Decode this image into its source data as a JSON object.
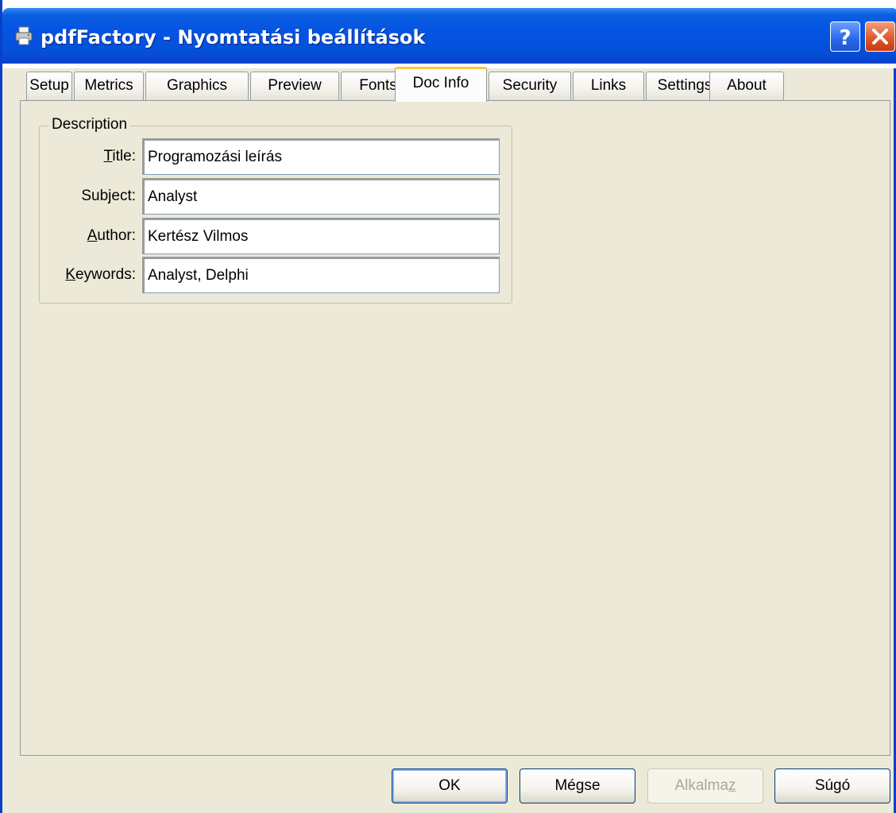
{
  "window": {
    "title": "pdfFactory - Nyomtatási beállítások",
    "help_icon": "help-icon",
    "close_icon": "close-icon"
  },
  "tabs": [
    {
      "label": "Setup"
    },
    {
      "label": "Metrics"
    },
    {
      "label": "Graphics"
    },
    {
      "label": "Preview"
    },
    {
      "label": "Fonts"
    },
    {
      "label": "Doc Info",
      "active": true
    },
    {
      "label": "Security"
    },
    {
      "label": "Links"
    },
    {
      "label": "Settings"
    },
    {
      "label": "About"
    }
  ],
  "description": {
    "legend": "Description",
    "fields": {
      "title": {
        "label_accel": "T",
        "label_rest": "itle:",
        "value": "Programozási leírás"
      },
      "subject": {
        "label": "Subject:",
        "value": "Analyst"
      },
      "author": {
        "label_accel": "A",
        "label_rest": "uthor:",
        "value": "Kertész Vilmos"
      },
      "keywords": {
        "label_accel": "K",
        "label_rest": "eywords:",
        "value": "Analyst, Delphi"
      }
    }
  },
  "buttons": {
    "ok": "OK",
    "cancel": "Mégse",
    "apply_pre": "Alkalma",
    "apply_accel": "z",
    "help": "Súgó"
  },
  "colors": {
    "titlebar_blue": "#0554e3",
    "active_tab_accent": "#ffc83c",
    "dialog_background": "#ece9d8"
  }
}
